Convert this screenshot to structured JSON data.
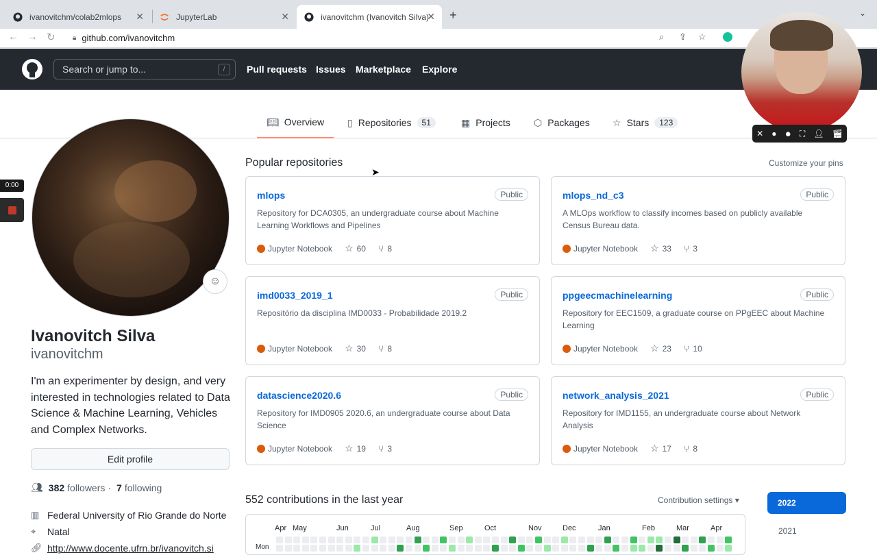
{
  "browser": {
    "tabs": [
      {
        "title": "ivanovitchm/colab2mlops"
      },
      {
        "title": "JupyterLab"
      },
      {
        "title": "ivanovitchm (Ivanovitch Silva)"
      }
    ],
    "url": "github.com/ivanovitchm"
  },
  "github": {
    "search_placeholder": "Search or jump to...",
    "slash": "/",
    "nav": [
      "Pull requests",
      "Issues",
      "Marketplace",
      "Explore"
    ]
  },
  "profile_tabs": [
    {
      "label": "Overview",
      "count": ""
    },
    {
      "label": "Repositories",
      "count": "51"
    },
    {
      "label": "Projects",
      "count": ""
    },
    {
      "label": "Packages",
      "count": ""
    },
    {
      "label": "Stars",
      "count": "123"
    }
  ],
  "profile": {
    "name": "Ivanovitch Silva",
    "login": "ivanovitchm",
    "bio": "I'm an experimenter by design, and very interested in technologies related to Data Science & Machine Learning, Vehicles and Complex Networks.",
    "edit_label": "Edit profile",
    "followers": "382",
    "followers_label": "followers",
    "following": "7",
    "following_label": "following",
    "separator": "·",
    "org": "Federal University of Rio Grande do Norte",
    "location": "Natal",
    "website": "http://www.docente.ufrn.br/ivanovitch.si"
  },
  "recording": {
    "time": "0:00"
  },
  "popular": {
    "title": "Popular repositories",
    "customize": "Customize your pins",
    "repos": [
      {
        "name": "mlops",
        "visibility": "Public",
        "desc": "Repository for DCA0305, an undergraduate course about Machine Learning Workflows and Pipelines",
        "language": "Jupyter Notebook",
        "lang_color": "#DA5B0B",
        "stars": "60",
        "forks": "8"
      },
      {
        "name": "mlops_nd_c3",
        "visibility": "Public",
        "desc": "A MLOps workflow to classify incomes based on publicly available Census Bureau data.",
        "language": "Jupyter Notebook",
        "lang_color": "#DA5B0B",
        "stars": "33",
        "forks": "3"
      },
      {
        "name": "imd0033_2019_1",
        "visibility": "Public",
        "desc": "Repositório da disciplina IMD0033 - Probabilidade 2019.2",
        "language": "Jupyter Notebook",
        "lang_color": "#DA5B0B",
        "stars": "30",
        "forks": "8"
      },
      {
        "name": "ppgeecmachinelearning",
        "visibility": "Public",
        "desc": "Repository for EEC1509, a graduate course on PPgEEC about Machine Learning",
        "language": "Jupyter Notebook",
        "lang_color": "#DA5B0B",
        "stars": "23",
        "forks": "10"
      },
      {
        "name": "datascience2020.6",
        "visibility": "Public",
        "desc": "Repository for IMD0905 2020.6, an undergraduate course about Data Science",
        "language": "Jupyter Notebook",
        "lang_color": "#DA5B0B",
        "stars": "19",
        "forks": "3"
      },
      {
        "name": "network_analysis_2021",
        "visibility": "Public",
        "desc": "Repository for IMD1155, an undergraduate course about Network Analysis",
        "language": "Jupyter Notebook",
        "lang_color": "#DA5B0B",
        "stars": "17",
        "forks": "8"
      }
    ]
  },
  "contributions": {
    "title": "552 contributions in the last year",
    "settings": "Contribution settings ▾",
    "months": [
      "Apr",
      "May",
      "Jun",
      "Jul",
      "Aug",
      "Sep",
      "Oct",
      "Nov",
      "Dec",
      "Jan",
      "Feb",
      "Mar",
      "Apr"
    ],
    "day_label": "Mon",
    "years": [
      "2022",
      "2021"
    ],
    "colors": {
      "empty": "#ebedf0",
      "l1": "#9be9a8",
      "l2": "#40c463",
      "l3": "#30a14e",
      "l4": "#216e39"
    }
  }
}
